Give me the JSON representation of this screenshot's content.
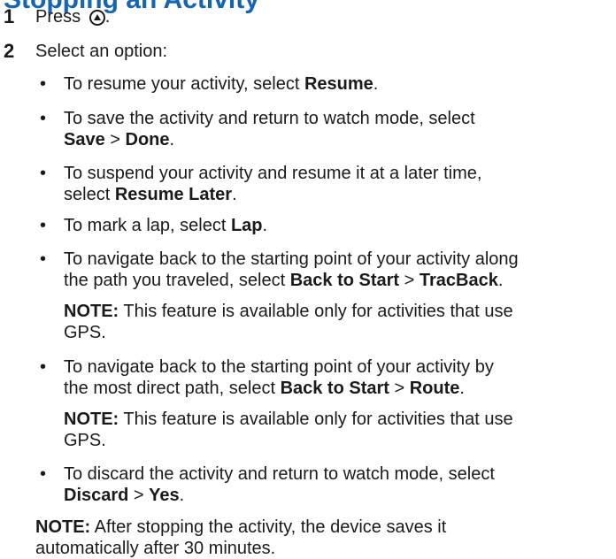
{
  "title": "Stopping an Activity",
  "step1": {
    "number": "1",
    "text": "Press",
    "suffix": "."
  },
  "step2": {
    "number": "2",
    "text": "Select an option:"
  },
  "options": [
    {
      "lines": [
        [
          "To resume your activity, select ",
          "Resume",
          "."
        ]
      ]
    },
    {
      "lines": [
        [
          "To save the activity and return to watch mode, select"
        ],
        [
          "",
          "Save",
          " > ",
          "Done",
          "."
        ]
      ]
    },
    {
      "lines": [
        [
          "To suspend your activity and resume it at a later time,"
        ],
        [
          "select ",
          "Resume Later",
          "."
        ]
      ]
    },
    {
      "lines": [
        [
          "To mark a lap, select ",
          "Lap",
          "."
        ]
      ]
    },
    {
      "lines": [
        [
          "To navigate back to the starting point of your activity along"
        ],
        [
          "the path you traveled, select ",
          "Back to Start",
          " > ",
          "TracBack",
          "."
        ]
      ]
    },
    {
      "lines": [
        [
          "To navigate back to the starting point of your activity by"
        ],
        [
          "the most direct path, select ",
          "Back to Start",
          " > ",
          "Route",
          "."
        ]
      ]
    },
    {
      "lines": [
        [
          "To discard the activity and return to watch mode, select"
        ],
        [
          "",
          "Discard",
          " > ",
          "Yes",
          "."
        ]
      ]
    }
  ],
  "bullet": "•",
  "gps_note": {
    "label": "NOTE:",
    "line1": " This feature is available only for activities that use",
    "line2": "GPS."
  },
  "final_note": {
    "label": "NOTE:",
    "line1": " After stopping the activity, the device saves it",
    "line2": "automatically after 30 minutes."
  }
}
